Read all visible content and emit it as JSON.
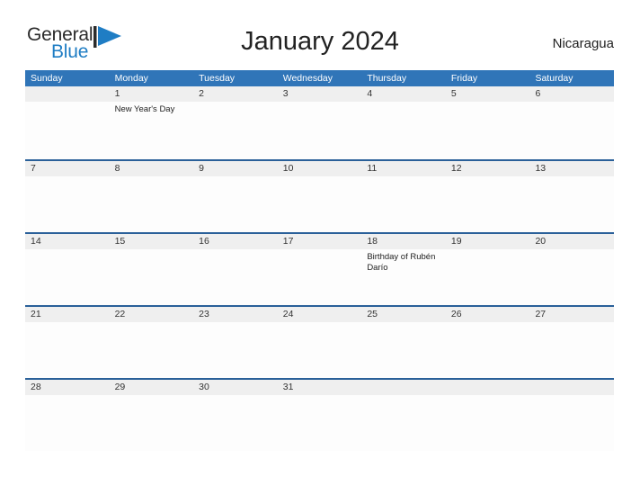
{
  "brand": {
    "name_top": "General",
    "name_bottom": "Blue",
    "flag_icon": "blue-triangle-flag-icon",
    "color_primary": "#1f7dc4",
    "color_text": "#2b2b2b"
  },
  "header": {
    "title": "January 2024",
    "region": "Nicaragua"
  },
  "theme": {
    "header_blue": "#3075b8",
    "separator_blue": "#2a6099",
    "number_band_gray": "#efefef",
    "text_dark": "#222222"
  },
  "calendar": {
    "weekdays": [
      "Sunday",
      "Monday",
      "Tuesday",
      "Wednesday",
      "Thursday",
      "Friday",
      "Saturday"
    ],
    "weeks": [
      [
        {
          "day": "",
          "events": []
        },
        {
          "day": "1",
          "events": [
            "New Year's Day"
          ]
        },
        {
          "day": "2",
          "events": []
        },
        {
          "day": "3",
          "events": []
        },
        {
          "day": "4",
          "events": []
        },
        {
          "day": "5",
          "events": []
        },
        {
          "day": "6",
          "events": []
        }
      ],
      [
        {
          "day": "7",
          "events": []
        },
        {
          "day": "8",
          "events": []
        },
        {
          "day": "9",
          "events": []
        },
        {
          "day": "10",
          "events": []
        },
        {
          "day": "11",
          "events": []
        },
        {
          "day": "12",
          "events": []
        },
        {
          "day": "13",
          "events": []
        }
      ],
      [
        {
          "day": "14",
          "events": []
        },
        {
          "day": "15",
          "events": []
        },
        {
          "day": "16",
          "events": []
        },
        {
          "day": "17",
          "events": []
        },
        {
          "day": "18",
          "events": [
            "Birthday of Rubén Darío"
          ]
        },
        {
          "day": "19",
          "events": []
        },
        {
          "day": "20",
          "events": []
        }
      ],
      [
        {
          "day": "21",
          "events": []
        },
        {
          "day": "22",
          "events": []
        },
        {
          "day": "23",
          "events": []
        },
        {
          "day": "24",
          "events": []
        },
        {
          "day": "25",
          "events": []
        },
        {
          "day": "26",
          "events": []
        },
        {
          "day": "27",
          "events": []
        }
      ],
      [
        {
          "day": "28",
          "events": []
        },
        {
          "day": "29",
          "events": []
        },
        {
          "day": "30",
          "events": []
        },
        {
          "day": "31",
          "events": []
        },
        {
          "day": "",
          "events": []
        },
        {
          "day": "",
          "events": []
        },
        {
          "day": "",
          "events": []
        }
      ]
    ]
  }
}
